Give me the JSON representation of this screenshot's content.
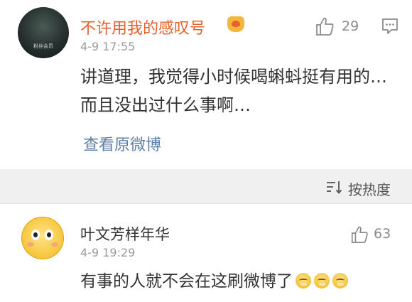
{
  "comments": [
    {
      "username": "不许用我的感叹号",
      "avatar_caption": "粉丝会员",
      "time": "4-9 17:55",
      "likes": "29",
      "text": "讲道理，我觉得小时候喝蝌蚪挺有用的…而且没出过什么事啊…",
      "view_original": "查看原微博",
      "icons": {
        "avatar": "joker-avatar",
        "badge": "vip-badge-icon",
        "like": "thumbs-up-icon",
        "reply": "message-icon"
      }
    },
    {
      "username": "叶文芳样年华",
      "time": "4-9 19:29",
      "likes": "63",
      "text": "有事的人就不会在这刷微博了",
      "emoji_count": 3,
      "icons": {
        "avatar": "emoji-avatar",
        "like": "thumbs-up-icon",
        "inline": "crying-laugh-emoji"
      }
    }
  ],
  "sort": {
    "label": "按热度",
    "icon": "sort-icon"
  },
  "colors": {
    "username_highlight": "#e8612c",
    "link": "#5d7fa6",
    "separator": "#f0f0f0",
    "meta": "#9b9b9b"
  }
}
